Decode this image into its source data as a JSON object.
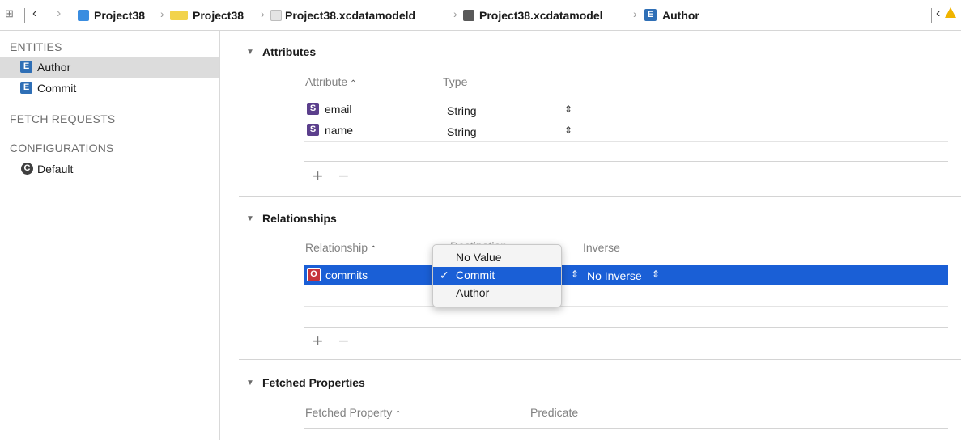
{
  "toolbar": {
    "crumbs": [
      {
        "label": "Project38",
        "icon": "app-project-icon"
      },
      {
        "label": "Project38",
        "icon": "folder-icon"
      },
      {
        "label": "Project38.xcdatamodeld",
        "icon": "datamodel-bundle-icon"
      },
      {
        "label": "Project38.xcdatamodel",
        "icon": "datamodel-file-icon"
      },
      {
        "label": "Author",
        "icon": "entity-icon"
      }
    ],
    "entity_badge": "E"
  },
  "sidebar": {
    "entities_header": "ENTITIES",
    "entities": [
      {
        "badge": "E",
        "label": "Author",
        "selected": true
      },
      {
        "badge": "E",
        "label": "Commit",
        "selected": false
      }
    ],
    "fetch_requests_header": "FETCH REQUESTS",
    "configurations_header": "CONFIGURATIONS",
    "configurations": [
      {
        "badge": "C",
        "label": "Default"
      }
    ]
  },
  "attributes": {
    "title": "Attributes",
    "col_attribute": "Attribute",
    "col_type": "Type",
    "rows": [
      {
        "badge": "S",
        "name": "email",
        "type": "String"
      },
      {
        "badge": "S",
        "name": "name",
        "type": "String"
      }
    ],
    "add": "+",
    "remove": "−"
  },
  "relationships": {
    "title": "Relationships",
    "col_relationship": "Relationship",
    "col_destination": "Destination",
    "col_inverse": "Inverse",
    "rows": [
      {
        "badge": "O",
        "name": "commits",
        "inverse": "No Inverse"
      }
    ],
    "popup": {
      "options": [
        "No Value",
        "Commit",
        "Author"
      ],
      "selected": "Commit",
      "checkmark": "✓"
    },
    "add": "+",
    "remove": "−"
  },
  "fetched_properties": {
    "title": "Fetched Properties",
    "col_fetched_property": "Fetched Property",
    "col_predicate": "Predicate"
  },
  "colors": {
    "selection": "#1a5fd6",
    "entity_badge": "#2f6fb6",
    "string_badge": "#5b3f8c",
    "relationship_badge": "#c6333b",
    "warning": "#f0b400"
  }
}
